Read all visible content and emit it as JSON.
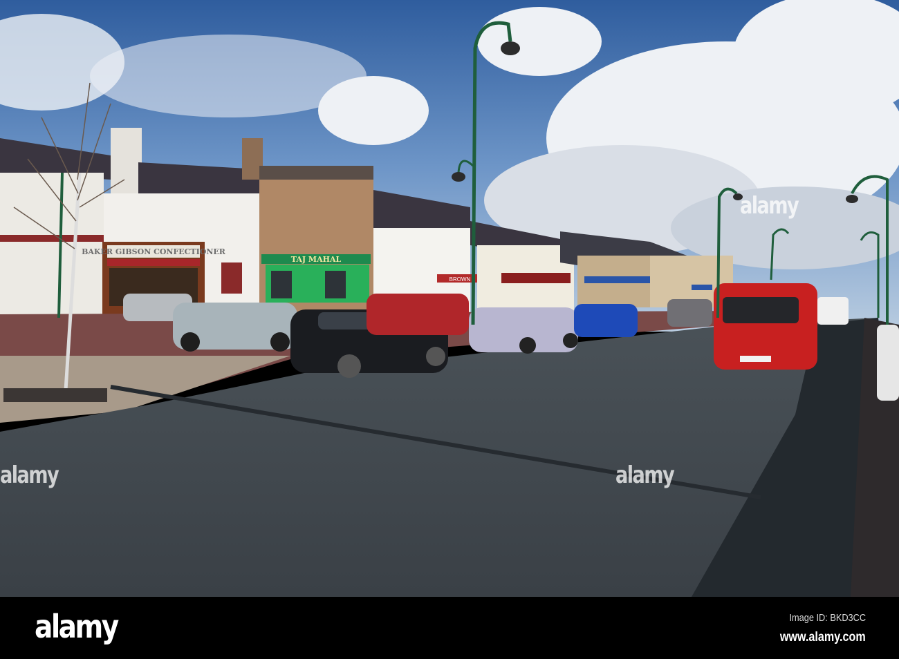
{
  "photo": {
    "description_signs": {
      "bakery_sign": "BAKER GIBSON CONFECTIONER",
      "restaurant_sign": "TAJ MAHAL",
      "shop_sign": "BROWN"
    },
    "watermark": "alamy"
  },
  "footer": {
    "logo": "alamy",
    "image_id": "Image ID: BKD3CC",
    "website": "www.alamy.com"
  }
}
